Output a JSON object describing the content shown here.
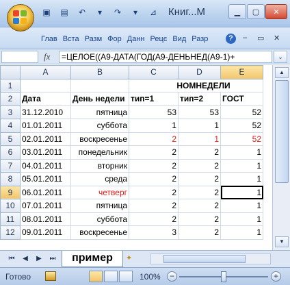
{
  "window": {
    "title": "Книг...М"
  },
  "ribbon": {
    "tabs": [
      "Глав",
      "Вста",
      "Разм",
      "Фор",
      "Данн",
      "Рецє",
      "Вид",
      "Разр"
    ],
    "help": "?"
  },
  "formula_bar": {
    "fx": "fx",
    "formula": "=ЦЕЛОЕ((A9-ДАТА(ГОД(A9-ДЕНЬНЕД(A9-1)+",
    "expand": "⌄"
  },
  "columns": [
    "A",
    "B",
    "C",
    "D",
    "E"
  ],
  "rows": [
    {
      "num": "1",
      "cells": [
        "",
        "",
        "НОМНЕДЕЛИ",
        "",
        ""
      ]
    },
    {
      "num": "2",
      "cells": [
        "Дата",
        "День недели",
        "тип=1",
        "тип=2",
        "ГОСТ"
      ]
    },
    {
      "num": "3",
      "cells": [
        "31.12.2010",
        "пятница",
        "53",
        "53",
        "52"
      ]
    },
    {
      "num": "4",
      "cells": [
        "01.01.2011",
        "суббота",
        "1",
        "1",
        "52"
      ]
    },
    {
      "num": "5",
      "cells": [
        "02.01.2011",
        "воскресенье",
        "2",
        "1",
        "52"
      ]
    },
    {
      "num": "6",
      "cells": [
        "03.01.2011",
        "понедельник",
        "2",
        "2",
        "1"
      ]
    },
    {
      "num": "7",
      "cells": [
        "04.01.2011",
        "вторник",
        "2",
        "2",
        "1"
      ]
    },
    {
      "num": "8",
      "cells": [
        "05.01.2011",
        "среда",
        "2",
        "2",
        "1"
      ]
    },
    {
      "num": "9",
      "cells": [
        "06.01.2011",
        "четверг",
        "2",
        "2",
        "1"
      ]
    },
    {
      "num": "10",
      "cells": [
        "07.01.2011",
        "пятница",
        "2",
        "2",
        "1"
      ]
    },
    {
      "num": "11",
      "cells": [
        "08.01.2011",
        "суббота",
        "2",
        "2",
        "1"
      ]
    },
    {
      "num": "12",
      "cells": [
        "09.01.2011",
        "воскресенье",
        "3",
        "2",
        "1"
      ]
    }
  ],
  "active_cell": {
    "row": "9",
    "col": "E"
  },
  "sheet": {
    "tab": "пример"
  },
  "status": {
    "text": "Готово",
    "zoom": "100%",
    "zoom_minus": "−",
    "zoom_plus": "+"
  },
  "colors": {
    "red_text": "#e41b17",
    "selection_header": "#f3c56b",
    "ribbon": "#c6daf2"
  },
  "icons": {
    "office": "office-button-icon",
    "save": "save-icon",
    "undo": "undo-icon",
    "redo": "redo-icon",
    "minimize": "minimize-icon",
    "maximize": "maximize-icon",
    "close": "close-icon"
  }
}
